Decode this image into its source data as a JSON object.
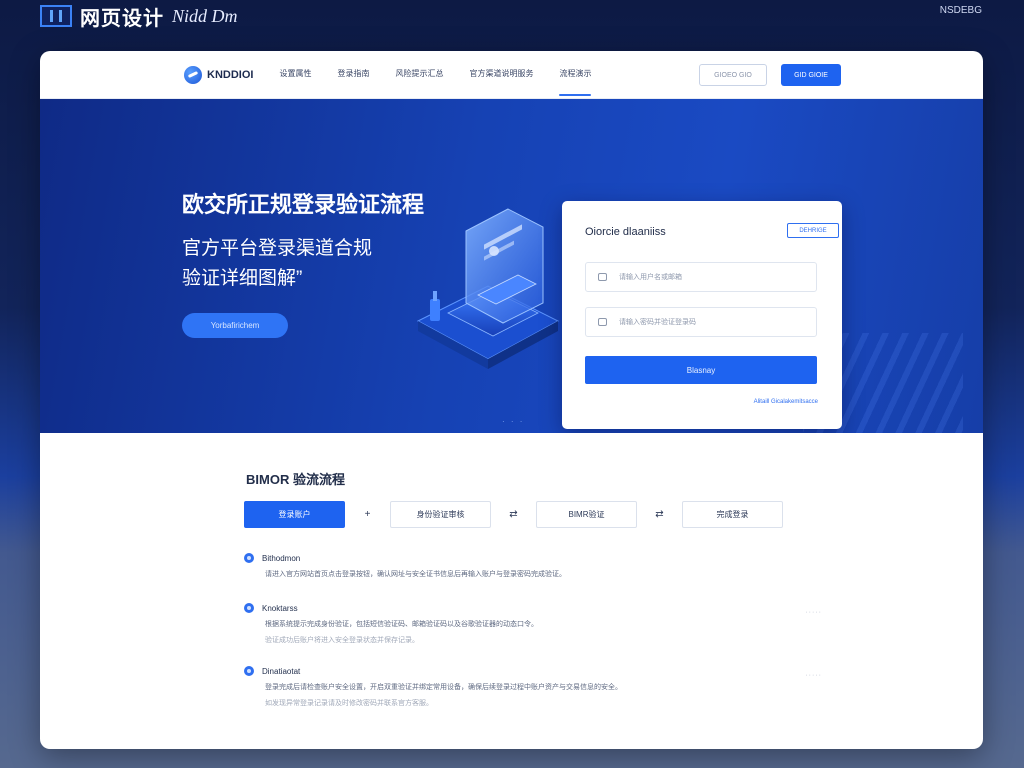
{
  "brand": {
    "title": "网页设计",
    "subtitle": "Nidd Dm",
    "corner_label": "NSDEBG"
  },
  "nav": {
    "logo_text": "KNDDIOI",
    "links": [
      {
        "label": "设置属性"
      },
      {
        "label": "登录指南"
      },
      {
        "label": "风险提示汇总"
      },
      {
        "label": "官方渠道说明服务"
      },
      {
        "label": "流程演示"
      }
    ],
    "login_button": "GIOEO GIO",
    "register_button": "GID GIOIE"
  },
  "hero": {
    "title": "欧交所正规登录验证流程",
    "subtitle_line1": "官方平台登录渠道合规",
    "subtitle_line2": "验证详细图解”",
    "cta": "Yorbafirichem",
    "dots": "· · ·"
  },
  "login": {
    "title": "Oiorcie  dlaaniiss",
    "switch_label": "DEHRIGE",
    "username_placeholder": "请输入用户名或邮箱",
    "password_placeholder": "请输入密码并验证登录码",
    "submit": "Blasnay",
    "links": "Alitaill  Gicalakemitsacce"
  },
  "steps": {
    "title": "BIMOR 验流流程",
    "tabs": [
      {
        "label": "登录账户",
        "active": true
      },
      {
        "label": "身份验证审核",
        "active": false
      },
      {
        "label": "BIMR验证",
        "active": false
      },
      {
        "label": "完成登录",
        "active": false
      }
    ],
    "tab_separators": [
      "+",
      "⇄",
      "⇄"
    ],
    "items": [
      {
        "name": "Bithodmon",
        "lines": [
          "请进入官方网站首页点击登录按钮，确认网址与安全证书信息后再输入账户与登录密码完成验证。"
        ],
        "more": ""
      },
      {
        "name": "Knoktarss",
        "lines": [
          "根据系统提示完成身份验证，包括短信验证码、邮箱验证码以及谷歌验证器的动态口令。",
          "验证成功后账户将进入安全登录状态并保存记录。"
        ],
        "more": "·····"
      },
      {
        "name": "Dinatiaotat",
        "lines": [
          "登录完成后请检查账户安全设置，开启双重验证并绑定常用设备，确保后续登录过程中账户资产与交易信息的安全。",
          "如发现异常登录记录请及时修改密码并联系官方客服。"
        ],
        "more": "·····"
      }
    ]
  }
}
